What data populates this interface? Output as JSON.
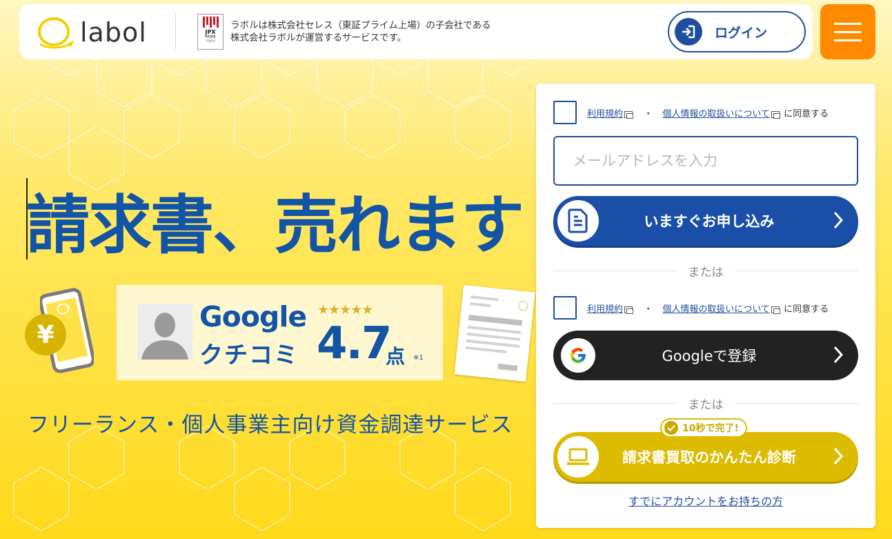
{
  "header": {
    "logo_text": "labol",
    "jpx": {
      "name": "JPX",
      "prime": "PRIME",
      "tokyo": "TOKYO"
    },
    "note": "ラボルは株式会社セレス（東証プライム上場）の子会社である株式会社ラボルが運営するサービスです。",
    "login_label": "ログイン"
  },
  "hero": {
    "title": "請求書、売れます",
    "yen": "¥",
    "review": {
      "google": "Google",
      "kuchikomi": "クチコミ",
      "stars": "★★★★★",
      "score": "4.7",
      "unit": "点",
      "note": "※1"
    },
    "tagline": "フリーランス・個人事業主向け資金調達サービス"
  },
  "signup": {
    "terms_link": "利用規約",
    "privacy_link": "個人情報の取扱いについて",
    "separator": "・",
    "agree_suffix": "に同意する",
    "email_placeholder": "メールアドレスを入力",
    "apply_label": "いますぐお申し込み",
    "or_label": "または",
    "google_label": "Googleで登録",
    "badge_label": "10秒で完了!",
    "diagnosis_label": "請求書買取のかんたん診断",
    "have_account": "すでにアカウントをお持ちの方"
  },
  "colors": {
    "brand_blue": "#1254a6",
    "button_blue": "#1a4fa8",
    "menu_orange": "#ff8a00",
    "diag_yellow": "#dcbb00",
    "google_dark": "#222222",
    "background_yellow": "#ffe24a"
  },
  "icons": [
    "labol-logo-icon",
    "login-icon",
    "hamburger-icon",
    "document-icon",
    "google-icon",
    "laptop-icon",
    "chevron-right-icon",
    "external-link-icon",
    "check-icon",
    "phone-icon",
    "yen-coin-icon"
  ]
}
